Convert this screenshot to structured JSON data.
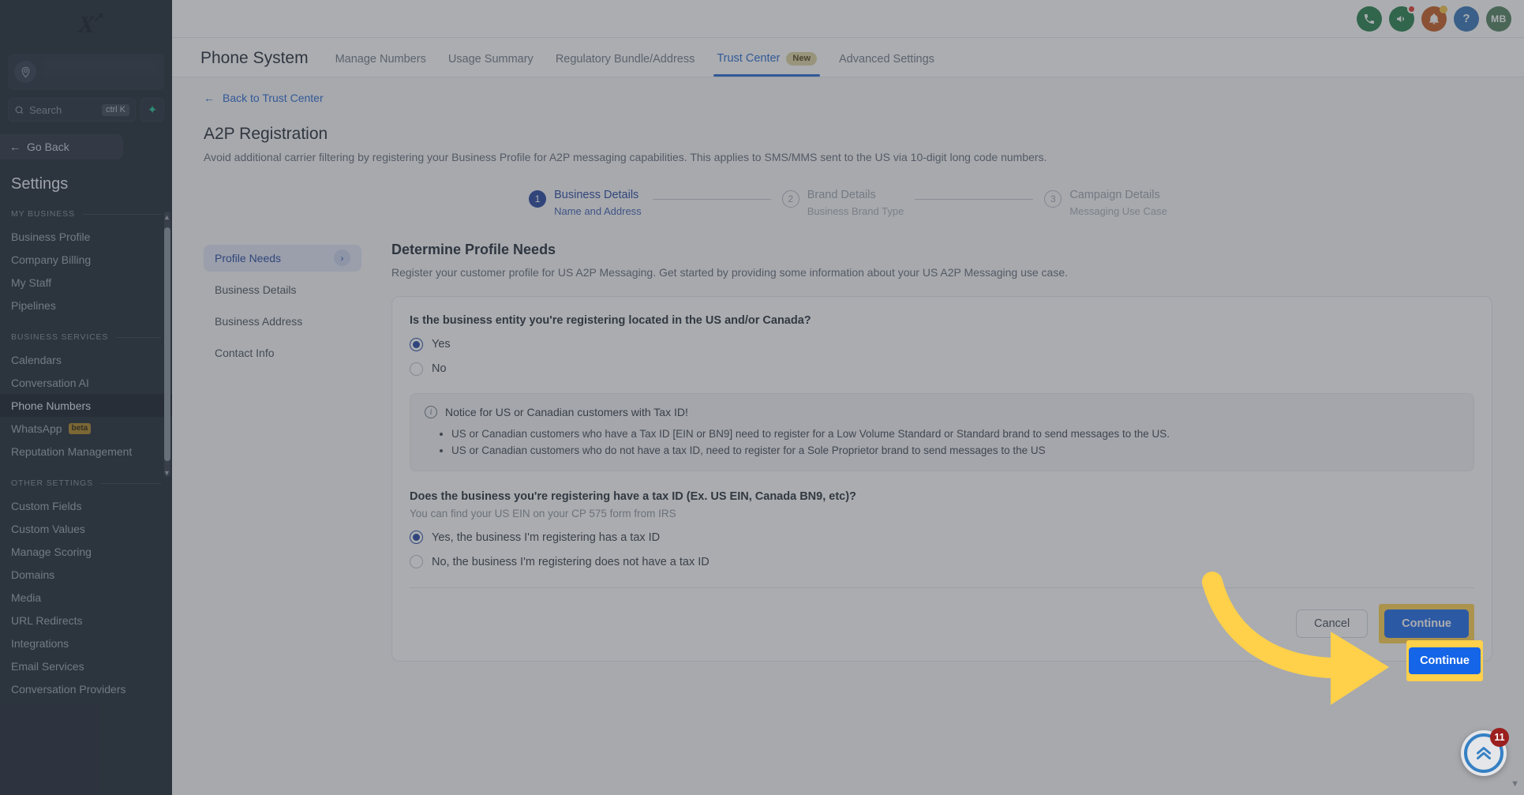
{
  "sidebar": {
    "logo_letter": "X",
    "search": {
      "placeholder": "Search",
      "shortcut": "ctrl K",
      "icon": "search-icon",
      "spark_icon": "sparkle-icon"
    },
    "go_back": "Go Back",
    "title": "Settings",
    "groups": [
      {
        "label": "MY BUSINESS",
        "items": [
          {
            "label": "Business Profile"
          },
          {
            "label": "Company Billing"
          },
          {
            "label": "My Staff"
          },
          {
            "label": "Pipelines"
          }
        ]
      },
      {
        "label": "BUSINESS SERVICES",
        "items": [
          {
            "label": "Calendars"
          },
          {
            "label": "Conversation AI"
          },
          {
            "label": "Phone Numbers",
            "active": true
          },
          {
            "label": "WhatsApp",
            "badge": "beta"
          },
          {
            "label": "Reputation Management"
          }
        ]
      },
      {
        "label": "OTHER SETTINGS",
        "items": [
          {
            "label": "Custom Fields"
          },
          {
            "label": "Custom Values"
          },
          {
            "label": "Manage Scoring"
          },
          {
            "label": "Domains"
          },
          {
            "label": "Media"
          },
          {
            "label": "URL Redirects"
          },
          {
            "label": "Integrations"
          },
          {
            "label": "Email Services"
          },
          {
            "label": "Conversation Providers"
          }
        ]
      }
    ]
  },
  "topbar": {
    "icons": [
      {
        "name": "phone-icon",
        "glyph": "✆"
      },
      {
        "name": "megaphone-icon",
        "glyph": "📣"
      },
      {
        "name": "bell-icon",
        "glyph": "🔔"
      },
      {
        "name": "help-icon",
        "glyph": "?"
      }
    ],
    "avatar_initials": "MB"
  },
  "tabs_bar": {
    "page_title": "Phone System",
    "tabs": [
      {
        "label": "Manage Numbers"
      },
      {
        "label": "Usage Summary"
      },
      {
        "label": "Regulatory Bundle/Address"
      },
      {
        "label": "Trust Center",
        "badge": "New",
        "active": true
      },
      {
        "label": "Advanced Settings"
      }
    ]
  },
  "page": {
    "back_link": "Back to Trust Center",
    "heading": "A2P Registration",
    "subheading": "Avoid additional carrier filtering by registering your Business Profile for A2P messaging capabilities. This applies to SMS/MMS sent to the US via 10-digit long code numbers."
  },
  "stepper": [
    {
      "num": "1",
      "title": "Business Details",
      "subtitle": "Name and Address",
      "state": "active"
    },
    {
      "num": "2",
      "title": "Brand Details",
      "subtitle": "Business Brand Type",
      "state": "todo"
    },
    {
      "num": "3",
      "title": "Campaign Details",
      "subtitle": "Messaging Use Case",
      "state": "todo"
    }
  ],
  "left_nav": [
    {
      "label": "Profile Needs",
      "active": true,
      "chevron": "chevron-right-icon"
    },
    {
      "label": "Business Details"
    },
    {
      "label": "Business Address"
    },
    {
      "label": "Contact Info"
    }
  ],
  "form": {
    "title": "Determine Profile Needs",
    "description": "Register your customer profile for US A2P Messaging. Get started by providing some information about your US A2P Messaging use case.",
    "question1": {
      "text": "Is the business entity you're registering located in the US and/or Canada?",
      "options": [
        {
          "label": "Yes",
          "selected": true
        },
        {
          "label": "No",
          "selected": false
        }
      ]
    },
    "notice": {
      "title": "Notice for US or Canadian customers with Tax ID!",
      "bullets": [
        "US or Canadian customers who have a Tax ID [EIN or BN9] need to register for a Low Volume Standard or Standard brand to send messages to the US.",
        "US or Canadian customers who do not have a tax ID, need to register for a Sole Proprietor brand to send messages to the US"
      ]
    },
    "question2": {
      "text": "Does the business you're registering have a tax ID (Ex. US EIN, Canada BN9, etc)?",
      "hint": "You can find your US EIN on your CP 575 form from IRS",
      "options": [
        {
          "label": "Yes, the business I'm registering has a tax ID",
          "selected": true
        },
        {
          "label": "No, the business I'm registering does not have a tax ID",
          "selected": false
        }
      ]
    },
    "actions": {
      "cancel": "Cancel",
      "continue": "Continue"
    }
  },
  "fab": {
    "count": "11",
    "icon": "chevrons-up-icon"
  },
  "colors": {
    "accent_blue": "#1565e8",
    "link_blue": "#2264d1",
    "step_blue": "#1e3f9e",
    "highlight_yellow": "#ffd04a",
    "sidebar_bg": "#16202e",
    "badge_beta": "#a9801c",
    "badge_new": "#ddd2a0"
  }
}
